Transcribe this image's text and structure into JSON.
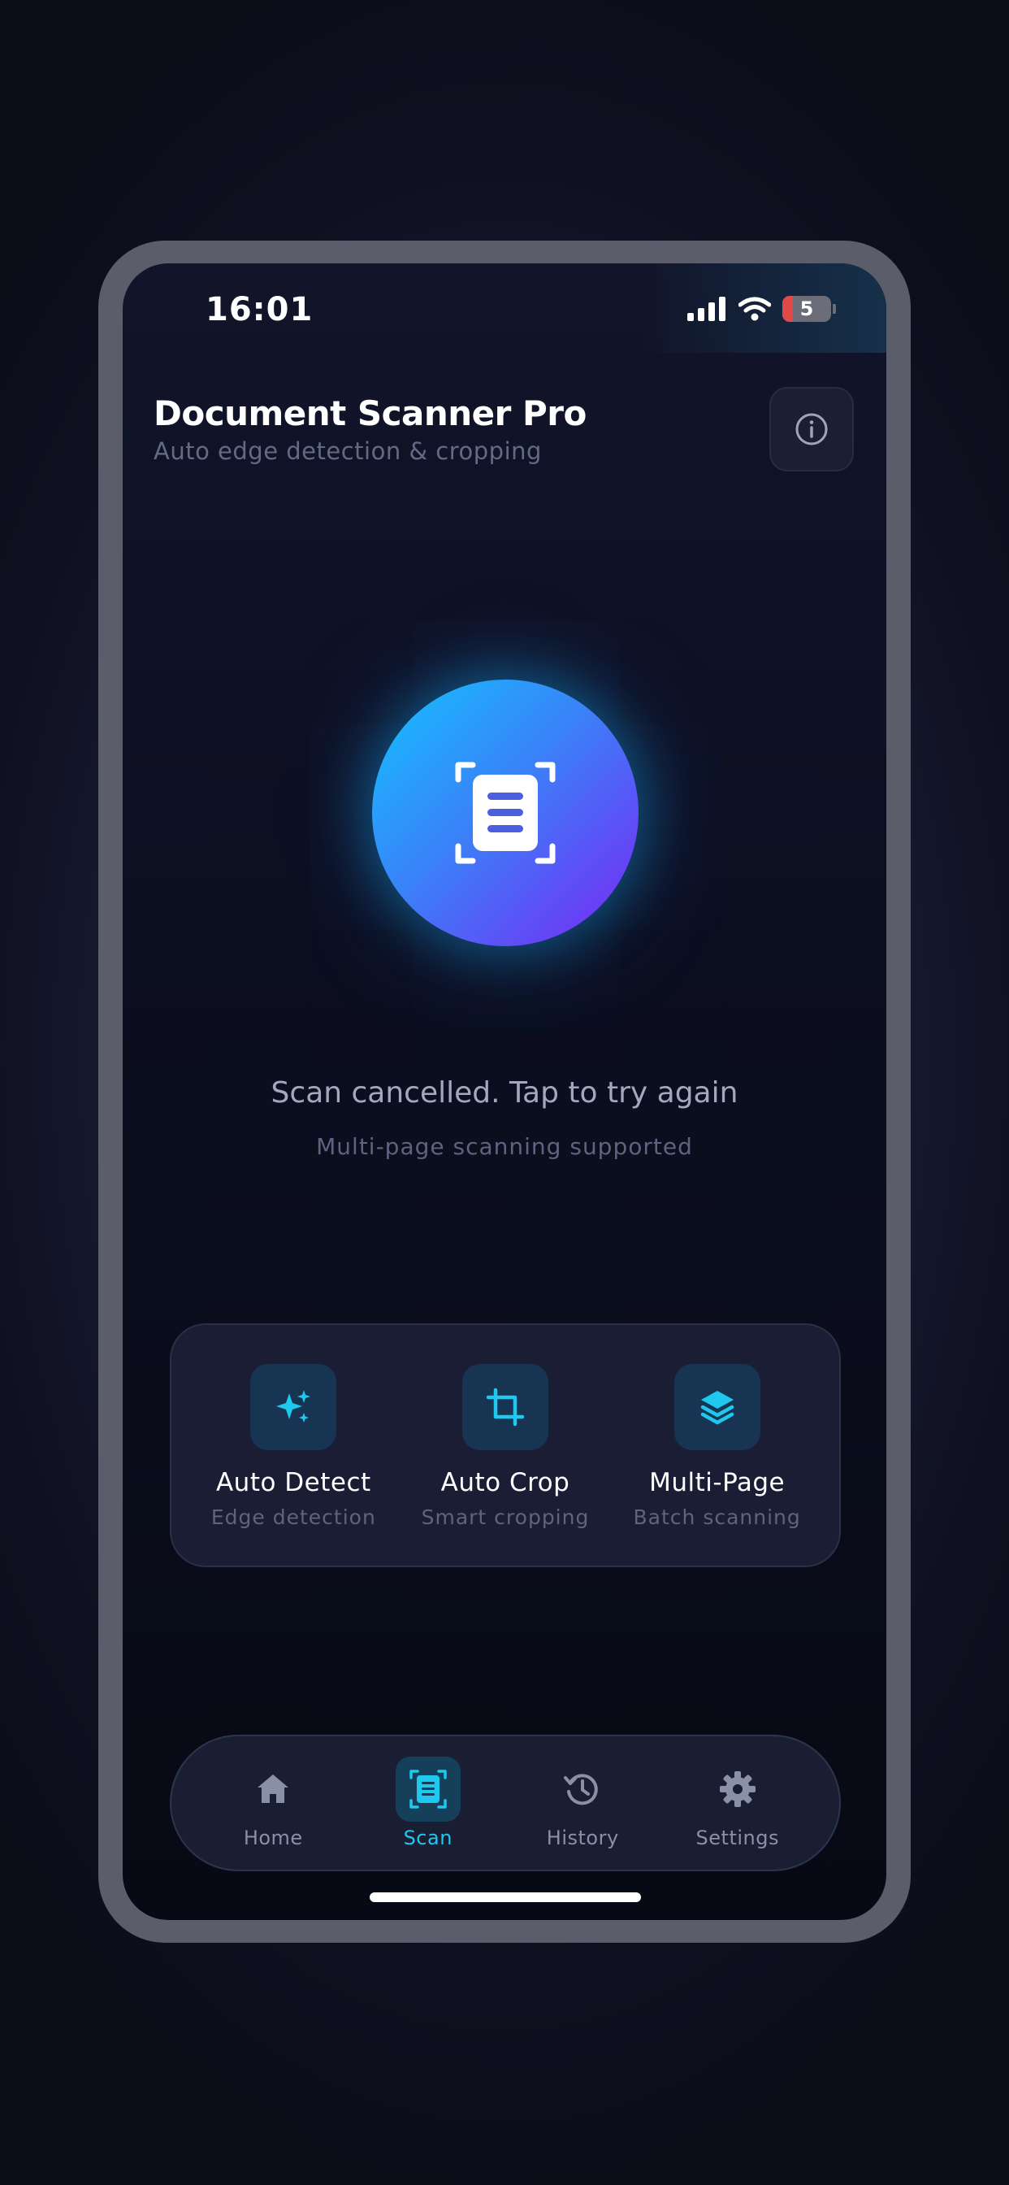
{
  "status_bar": {
    "time": "16:01",
    "battery_level": "5"
  },
  "header": {
    "title": "Document Scanner Pro",
    "subtitle": "Auto edge detection & cropping",
    "info_icon": "info-icon"
  },
  "scanner": {
    "icon": "document-scan-icon",
    "status": "Scan cancelled. Tap to try again",
    "hint": "Multi-page scanning supported"
  },
  "features": [
    {
      "icon": "sparkles-icon",
      "label": "Auto Detect",
      "sub": "Edge detection"
    },
    {
      "icon": "crop-icon",
      "label": "Auto Crop",
      "sub": "Smart cropping"
    },
    {
      "icon": "layers-icon",
      "label": "Multi-Page",
      "sub": "Batch scanning"
    }
  ],
  "tabs": [
    {
      "icon": "home-icon",
      "label": "Home",
      "active": false
    },
    {
      "icon": "scan-icon",
      "label": "Scan",
      "active": true
    },
    {
      "icon": "history-icon",
      "label": "History",
      "active": false
    },
    {
      "icon": "gear-icon",
      "label": "Settings",
      "active": false
    }
  ],
  "colors": {
    "accent": "#1fc8ee",
    "gradient_start": "#12c3ff",
    "gradient_end": "#7a26f5",
    "battery_low": "#e24848"
  }
}
